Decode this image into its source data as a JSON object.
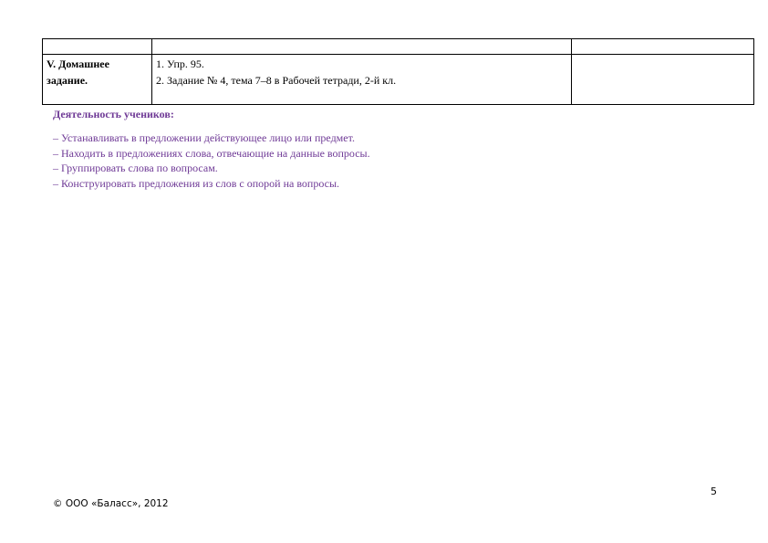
{
  "table": {
    "header_row": [
      "",
      "",
      ""
    ],
    "homework_row": {
      "stage_line1": "V. Домашнее",
      "stage_line2": "задание.",
      "task_1": "1. Упр. 95.",
      "task_2": "2. Задание № 4, тема 7–8  в Рабочей тетради, 2-й кл.",
      "notes": ""
    }
  },
  "activity": {
    "title": "Деятельность учеников:",
    "items": [
      "– Устанавливать в предложении действующее лицо или предмет.",
      "– Находить в предложениях слова, отвечающие на данные вопросы.",
      "– Группировать слова по вопросам.",
      "– Конструировать предложения из слов с опорой на вопросы."
    ]
  },
  "footer": {
    "page_number": "5",
    "copyright": "© ООО «Баласс», 2012"
  },
  "colors": {
    "activity_text": "#6f3a96",
    "table_border": "#000000"
  }
}
